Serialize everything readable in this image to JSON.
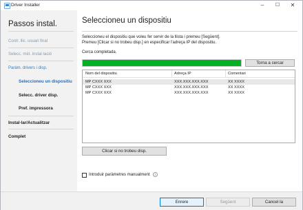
{
  "window": {
    "title": "Driver Installer"
  },
  "sidebar": {
    "title": "Passos instal.",
    "items": [
      {
        "label": "Contr. llic. usuari final"
      },
      {
        "label": "Selecc. mèt. instal·lació"
      },
      {
        "label": "Paràm. drivers i disp."
      },
      {
        "label": "Seleccioneu un dispositiu"
      },
      {
        "label": "Selecc. driver disp."
      },
      {
        "label": "Pref. impressora"
      },
      {
        "label": "Instal·lar/Actualitzar"
      },
      {
        "label": "Complet"
      }
    ]
  },
  "main": {
    "heading": "Seleccioneu un dispositiu",
    "instruction_line1": "Seleccioneu el dispositiu que voleu fer servir de la llista i premeu [Següent].",
    "instruction_line2": "Premeu [Clicar si no trobeu disp.] en especificar l'adreça IP del dispositiu.",
    "status": "Cerca completada.",
    "progress_fraction": 1.0,
    "search_again_label": "Torna a cercar",
    "table": {
      "columns": [
        "Nom del dispositiu",
        "Adreça IP",
        "Comentari"
      ],
      "rows": [
        [
          "MP CXXX XXX",
          "XXX.XXX.XXX.XXX",
          "XX XXXX"
        ],
        [
          "MP CXXX XXX",
          "XXX.XXX.XXX.XXX",
          "XX XXXX"
        ],
        [
          "MP CXXX XXX",
          "XXX.XXX.XXX.XXX",
          "XX XXXX"
        ]
      ]
    },
    "not_found_button": "Clicar si no trobeu disp.",
    "manual_params_label": "Introduir paràmetres manualment",
    "manual_params_checked": false
  },
  "footer": {
    "back_label": "Enrere",
    "next_label": "Següent",
    "cancel_label": "Cancel·la"
  },
  "colors": {
    "progress": "#06b025",
    "active_step": "#1f6fbf",
    "active_group": "#2f7cc4"
  }
}
